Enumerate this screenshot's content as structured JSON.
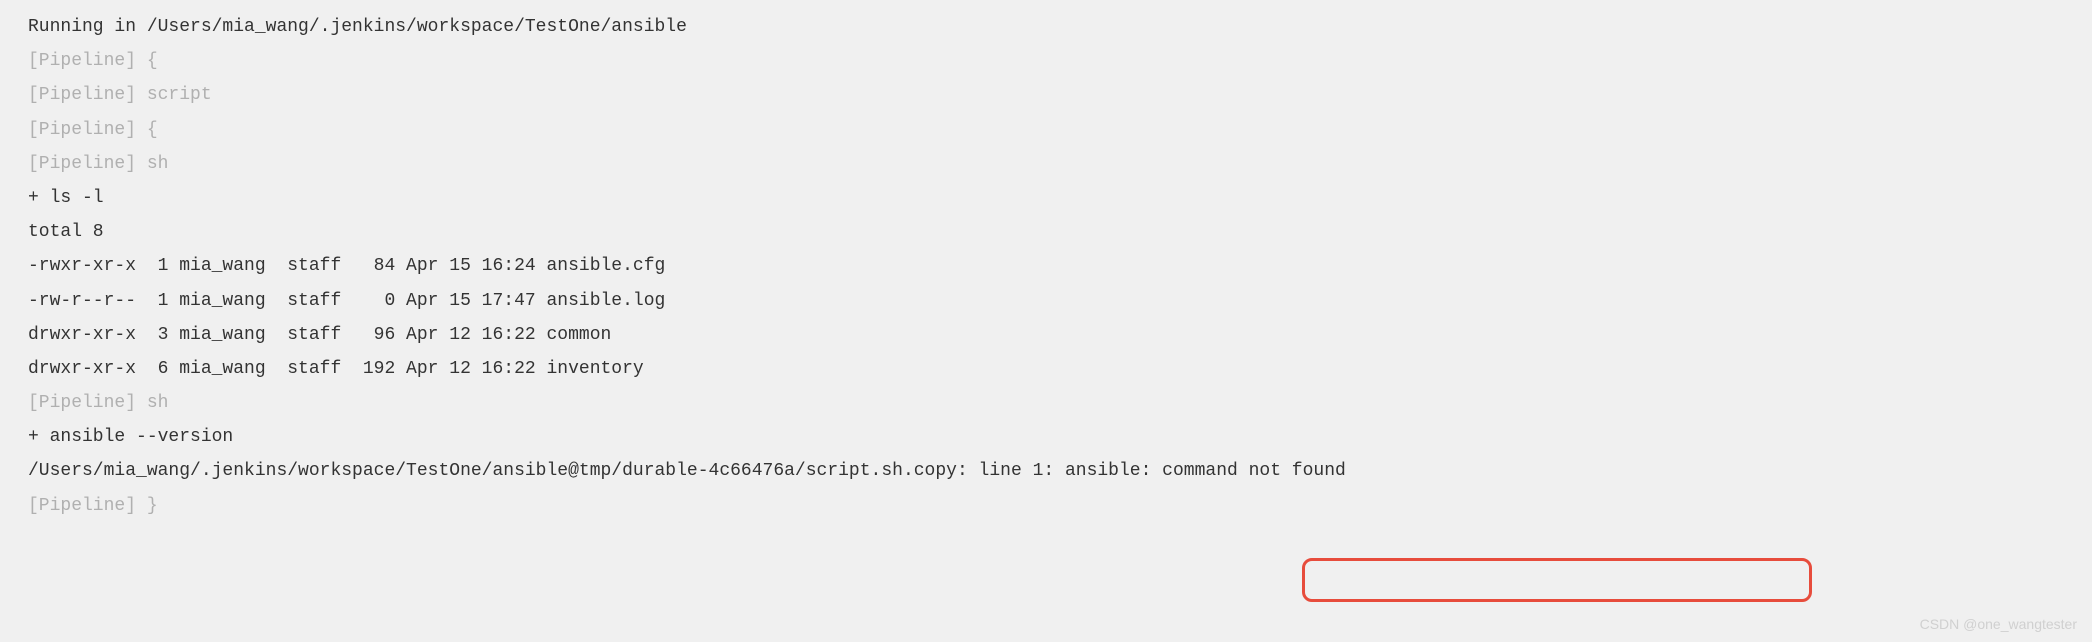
{
  "console": {
    "lines": [
      {
        "text": "Running in /Users/mia_wang/.jenkins/workspace/TestOne/ansible",
        "style": "dark"
      },
      {
        "text": "[Pipeline] {",
        "style": "pipeline"
      },
      {
        "text": "[Pipeline] script",
        "style": "pipeline"
      },
      {
        "text": "[Pipeline] {",
        "style": "pipeline"
      },
      {
        "text": "[Pipeline] sh",
        "style": "pipeline"
      },
      {
        "text": "+ ls -l",
        "style": "dark"
      },
      {
        "text": "total 8",
        "style": "dark"
      },
      {
        "text": "-rwxr-xr-x  1 mia_wang  staff   84 Apr 15 16:24 ansible.cfg",
        "style": "dark"
      },
      {
        "text": "-rw-r--r--  1 mia_wang  staff    0 Apr 15 17:47 ansible.log",
        "style": "dark"
      },
      {
        "text": "drwxr-xr-x  3 mia_wang  staff   96 Apr 12 16:22 common",
        "style": "dark"
      },
      {
        "text": "drwxr-xr-x  6 mia_wang  staff  192 Apr 12 16:22 inventory",
        "style": "dark"
      },
      {
        "text": "[Pipeline] sh",
        "style": "pipeline"
      },
      {
        "text": "+ ansible --version",
        "style": "dark"
      },
      {
        "text": "/Users/mia_wang/.jenkins/workspace/TestOne/ansible@tmp/durable-4c66476a/script.sh.copy: line 1: ansible: command not found",
        "style": "dark"
      },
      {
        "text": "[Pipeline] }",
        "style": "pipeline"
      }
    ]
  },
  "watermark": "CSDN @one_wangtester"
}
